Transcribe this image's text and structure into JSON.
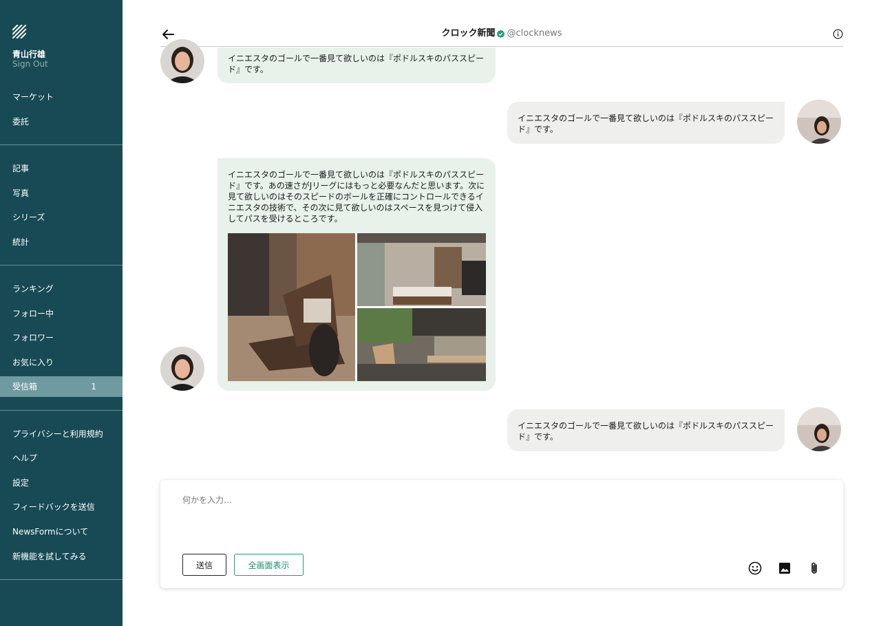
{
  "sidebar": {
    "user_name": "青山行雄",
    "sign_out": "Sign Out",
    "group1": [
      "マーケット",
      "委託"
    ],
    "group2": [
      "記事",
      "写真",
      "シリーズ",
      "統計"
    ],
    "group3": [
      "ランキング",
      "フォロー中",
      "フォロワー",
      "お気に入り",
      "受信箱"
    ],
    "inbox_badge": "1",
    "group4": [
      "プライバシーと利用規約",
      "ヘルプ",
      "設定",
      "フィードバックを送信",
      "NewsFormについて",
      "新機能を試してみる"
    ]
  },
  "header": {
    "title": "クロック新聞",
    "handle": "@clocknews"
  },
  "messages": {
    "m1": "イニエスタのゴールで一番見て欲しいのは『ポドルスキのパススピード』です。",
    "m2": "イニエスタのゴールで一番見て欲しいのは『ポドルスキのパススピード』です。",
    "m3": "イニエスタのゴールで一番見て欲しいのは『ポドルスキのパススピード』です。あの速さがJリーグにはもっと必要なんだと思います。次に見て欲しいのはそのスピードのボールを正確にコントロールできるイニエスタの技術で、その次に見て欲しいのはスペースを見つけて侵入してパスを受けるところです。",
    "m4": "イニエスタのゴールで一番見て欲しいのは『ポドルスキのパススピード』です。"
  },
  "composer": {
    "placeholder": "何かを入力…",
    "send_label": "送信",
    "fullscreen_label": "全画面表示"
  },
  "icons": {
    "back": "arrow-left-icon",
    "verified": "verified-badge-icon",
    "info": "info-icon",
    "emoji": "smiley-icon",
    "image": "image-icon",
    "attach": "paperclip-icon"
  },
  "colors": {
    "sidebar_bg": "#174a54",
    "active_item": "#6f9aa0",
    "incoming_bubble": "#e8f1ea",
    "outgoing_bubble": "#efefed",
    "accent_green": "#1f9a7a"
  }
}
